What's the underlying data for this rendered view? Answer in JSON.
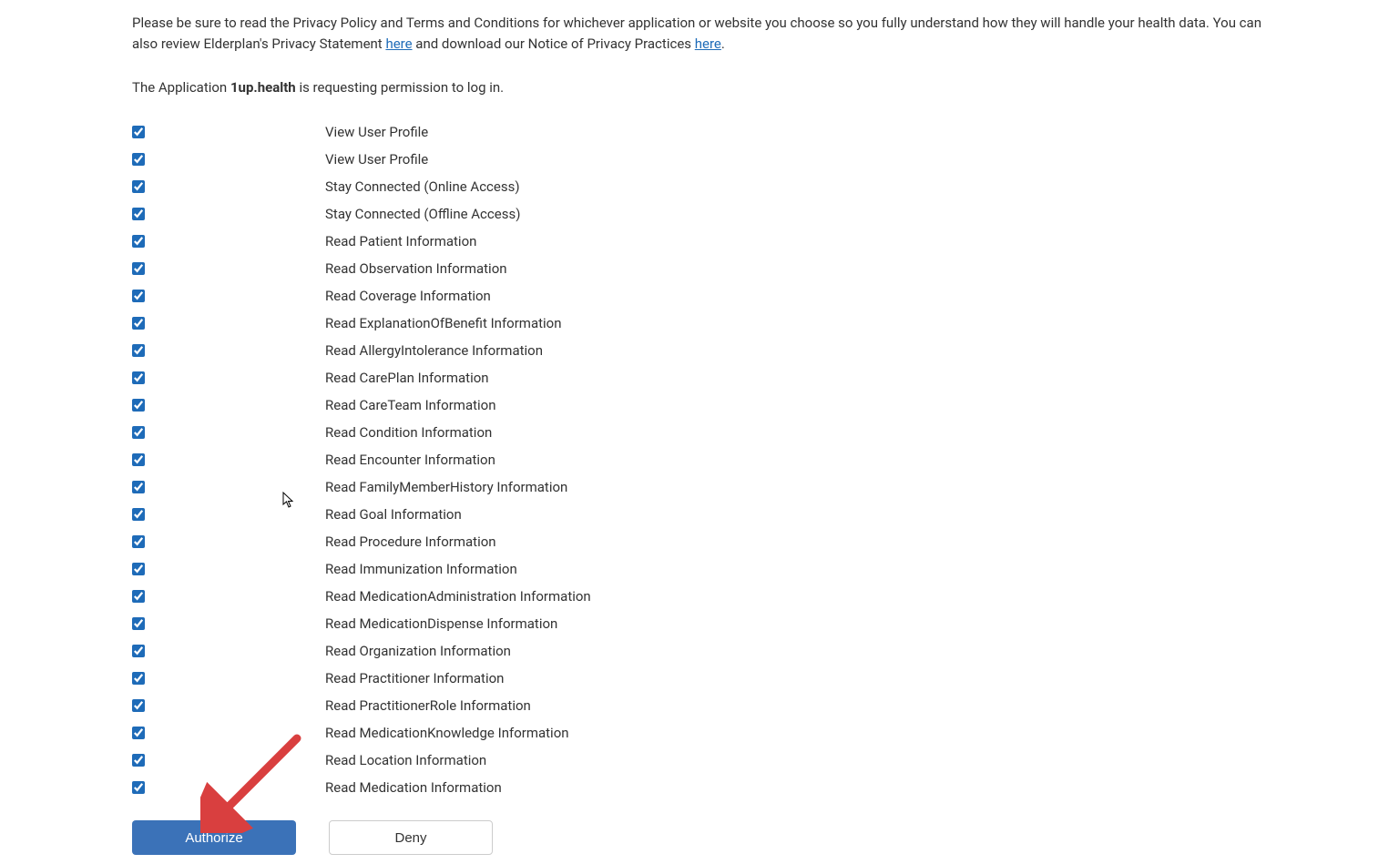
{
  "intro": {
    "text_before_link1": "Please be sure to read the Privacy Policy and Terms and Conditions for whichever application or website you choose so you fully understand how they will handle your health data. You can also review Elderplan's Privacy Statement ",
    "link1": "here",
    "text_between": " and download our Notice of Privacy Practices ",
    "link2": "here",
    "text_after": "."
  },
  "request": {
    "prefix": "The Application ",
    "app_name": "1up.health",
    "suffix": " is requesting permission to log in."
  },
  "permissions": [
    {
      "checked": true,
      "label": "View User Profile"
    },
    {
      "checked": true,
      "label": "View User Profile"
    },
    {
      "checked": true,
      "label": "Stay Connected (Online Access)"
    },
    {
      "checked": true,
      "label": "Stay Connected (Offline Access)"
    },
    {
      "checked": true,
      "label": "Read Patient Information"
    },
    {
      "checked": true,
      "label": "Read Observation Information"
    },
    {
      "checked": true,
      "label": "Read Coverage Information"
    },
    {
      "checked": true,
      "label": "Read ExplanationOfBenefit Information"
    },
    {
      "checked": true,
      "label": "Read AllergyIntolerance Information"
    },
    {
      "checked": true,
      "label": "Read CarePlan Information"
    },
    {
      "checked": true,
      "label": "Read CareTeam Information"
    },
    {
      "checked": true,
      "label": "Read Condition Information"
    },
    {
      "checked": true,
      "label": "Read Encounter Information"
    },
    {
      "checked": true,
      "label": "Read FamilyMemberHistory Information"
    },
    {
      "checked": true,
      "label": "Read Goal Information"
    },
    {
      "checked": true,
      "label": "Read Procedure Information"
    },
    {
      "checked": true,
      "label": "Read Immunization Information"
    },
    {
      "checked": true,
      "label": "Read MedicationAdministration Information"
    },
    {
      "checked": true,
      "label": "Read MedicationDispense Information"
    },
    {
      "checked": true,
      "label": "Read Organization Information"
    },
    {
      "checked": true,
      "label": "Read Practitioner Information"
    },
    {
      "checked": true,
      "label": "Read PractitionerRole Information"
    },
    {
      "checked": true,
      "label": "Read MedicationKnowledge Information"
    },
    {
      "checked": true,
      "label": "Read Location Information"
    },
    {
      "checked": true,
      "label": "Read Medication Information"
    }
  ],
  "buttons": {
    "authorize": "Authorize",
    "deny": "Deny"
  }
}
